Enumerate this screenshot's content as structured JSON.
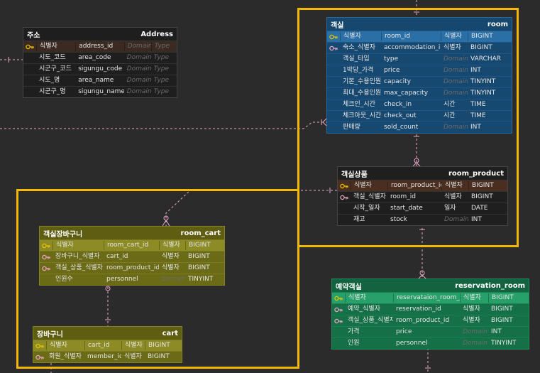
{
  "colors": {
    "background": "#2b2b2c",
    "highlight_frame": "#f5b800",
    "relation_line": "#e8a9c8",
    "pk_key": "#e6c400",
    "fk_key": "#e9a3c3"
  },
  "tables": {
    "address": {
      "label": "주소",
      "name": "Address",
      "rows": [
        {
          "key": "pk",
          "label": "식별자",
          "column": "address_id",
          "domain": "Domain",
          "type": "Type"
        },
        {
          "key": "",
          "label": "시도_코드",
          "column": "area_code",
          "domain": "Domain",
          "type": "Type"
        },
        {
          "key": "",
          "label": "시군구_코드",
          "column": "sigungu_code",
          "domain": "Domain",
          "type": "Type"
        },
        {
          "key": "",
          "label": "시도_명",
          "column": "area_name",
          "domain": "Domain",
          "type": "Type"
        },
        {
          "key": "",
          "label": "시군구_명",
          "column": "sigungu_name",
          "domain": "Domain",
          "type": "Type"
        }
      ]
    },
    "room": {
      "label": "객실",
      "name": "room",
      "rows": [
        {
          "key": "pk",
          "label": "식별자",
          "column": "room_id",
          "domain": "식별자",
          "type": "BIGINT"
        },
        {
          "key": "fk",
          "label": "숙소_식별자",
          "column": "accommodation_id",
          "domain": "식별자",
          "type": "BIGINT"
        },
        {
          "key": "",
          "label": "객실_타입",
          "column": "type",
          "domain": "Domain",
          "type": "VARCHAR"
        },
        {
          "key": "",
          "label": "1박당_가격",
          "column": "price",
          "domain": "Domain",
          "type": "INT"
        },
        {
          "key": "",
          "label": "기본_수용인원",
          "column": "capacity",
          "domain": "Domain",
          "type": "TINYINT"
        },
        {
          "key": "",
          "label": "최대_수용인원",
          "column": "max_capacity",
          "domain": "Domain",
          "type": "TINYINT"
        },
        {
          "key": "",
          "label": "체크인_시간",
          "column": "check_in",
          "domain": "시간",
          "type": "TIME"
        },
        {
          "key": "",
          "label": "체크아웃_시간",
          "column": "check_out",
          "domain": "시간",
          "type": "TIME"
        },
        {
          "key": "",
          "label": "판매량",
          "column": "sold_count",
          "domain": "Domain",
          "type": "INT"
        }
      ]
    },
    "room_product": {
      "label": "객실상품",
      "name": "room_product",
      "rows": [
        {
          "key": "pk",
          "label": "식별자",
          "column": "room_product_id",
          "domain": "식별자",
          "type": "BIGINT"
        },
        {
          "key": "fk",
          "label": "객실_식별자",
          "column": "room_id",
          "domain": "식별자",
          "type": "BIGINT"
        },
        {
          "key": "",
          "label": "시작_일자",
          "column": "start_date",
          "domain": "일자",
          "type": "DATE"
        },
        {
          "key": "",
          "label": "재고",
          "column": "stock",
          "domain": "Domain",
          "type": "INT"
        }
      ]
    },
    "room_cart": {
      "label": "객실장바구니",
      "name": "room_cart",
      "rows": [
        {
          "key": "pk",
          "label": "식별자",
          "column": "room_cart_id",
          "domain": "식별자",
          "type": "BIGINT"
        },
        {
          "key": "fk",
          "label": "장바구니_식별자",
          "column": "cart_id",
          "domain": "식별자",
          "type": "BIGINT"
        },
        {
          "key": "fk",
          "label": "객실_상품_식별자",
          "column": "room_product_id",
          "domain": "식별자",
          "type": "BIGINT"
        },
        {
          "key": "",
          "label": "인원수",
          "column": "personnel",
          "domain": "Domain",
          "type": "TINYINT"
        }
      ]
    },
    "cart": {
      "label": "장바구니",
      "name": "cart",
      "rows": [
        {
          "key": "pk",
          "label": "식별자",
          "column": "cart_id",
          "domain": "식별자",
          "type": "BIGINT"
        },
        {
          "key": "fk",
          "label": "회원_식별자",
          "column": "member_id",
          "domain": "식별자",
          "type": "BIGINT"
        }
      ]
    },
    "reservation_room": {
      "label": "예약객실",
      "name": "reservation_room",
      "rows": [
        {
          "key": "pk",
          "label": "식별자",
          "column": "reservataion_room_id",
          "domain": "식별자",
          "type": "BIGINT"
        },
        {
          "key": "fk",
          "label": "예약_식별자",
          "column": "reservation_id",
          "domain": "식별자",
          "type": "BIGINT"
        },
        {
          "key": "fk",
          "label": "객실_상품_식별자",
          "column": "room_product_id",
          "domain": "식별자",
          "type": "BIGINT"
        },
        {
          "key": "",
          "label": "가격",
          "column": "price",
          "domain": "Domain",
          "type": "INT"
        },
        {
          "key": "",
          "label": "인원",
          "column": "personnel",
          "domain": "Domain",
          "type": "TINYINT"
        }
      ]
    }
  }
}
